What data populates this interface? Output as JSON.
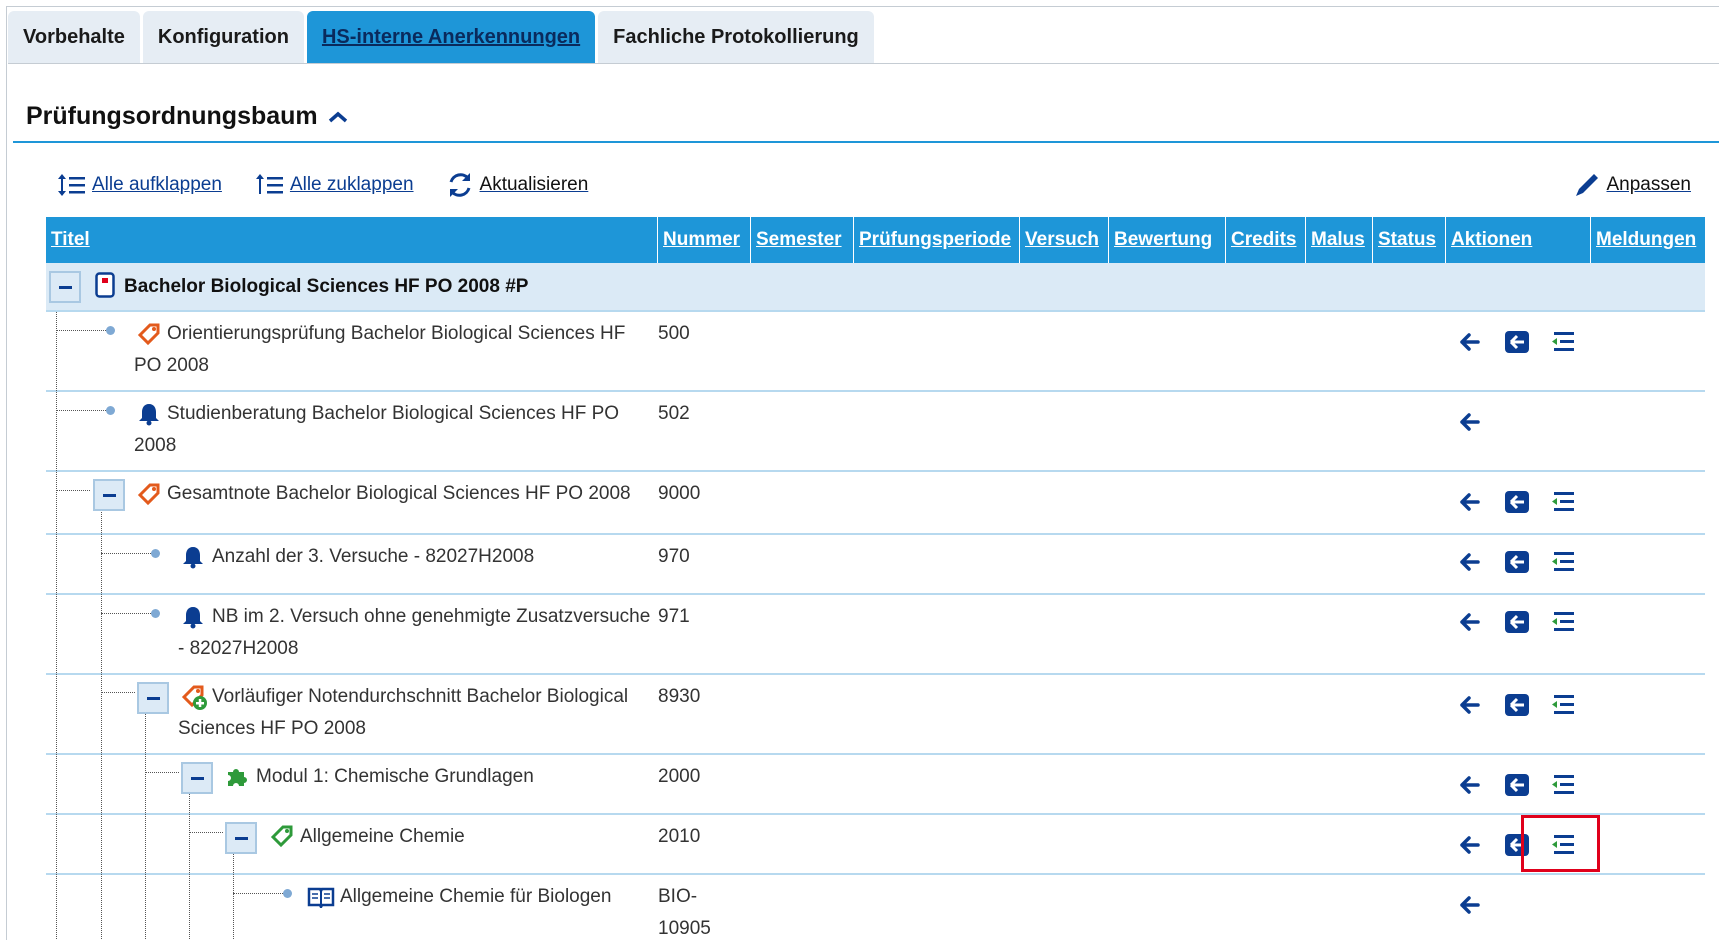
{
  "tabs": [
    {
      "label": "Vorbehalte"
    },
    {
      "label": "Konfiguration"
    },
    {
      "label": "HS-interne Anerkennungen",
      "active": true
    },
    {
      "label": "Fachliche Protokollierung"
    }
  ],
  "section": {
    "title": "Prüfungsordnungsbaum"
  },
  "toolbar": {
    "expand_all": "Alle aufklappen",
    "collapse_all": "Alle zuklappen",
    "refresh": "Aktualisieren",
    "customize": "Anpassen"
  },
  "columns": [
    "Titel",
    "Nummer",
    "Semester",
    "Prüfungsperiode",
    "Versuch",
    "Bewertung",
    "Credits",
    "Malus",
    "Status",
    "Aktionen",
    "Meldungen"
  ],
  "rows": [
    {
      "title": "Bachelor Biological Sciences HF PO 2008 #P",
      "number": "",
      "icon": "document-icon"
    },
    {
      "title_line1": "Orientierungsprüfung Bachelor Biological Sciences HF",
      "title_line2": "PO 2008",
      "number": "500",
      "icon": "tag-icon"
    },
    {
      "title_line1": "Studienberatung Bachelor Biological Sciences HF PO",
      "title_line2": "2008",
      "number": "502",
      "icon": "bell-icon"
    },
    {
      "title_line1": "Gesamtnote Bachelor Biological Sciences HF PO 2008",
      "number": "9000",
      "icon": "tag-icon"
    },
    {
      "title_line1": "Anzahl der 3. Versuche - 82027H2008",
      "number": "970",
      "icon": "bell-icon"
    },
    {
      "title_line1": "NB im 2. Versuch ohne genehmigte Zusatzversuche",
      "title_line2": "- 82027H2008",
      "number": "971",
      "icon": "bell-icon"
    },
    {
      "title_line1": "Vorläufiger Notendurchschnitt Bachelor Biological",
      "title_line2": "Sciences HF PO 2008",
      "number": "8930",
      "icon": "tag-plus-icon"
    },
    {
      "title_line1": "Modul 1: Chemische Grundlagen",
      "number": "2000",
      "icon": "puzzle-icon"
    },
    {
      "title_line1": "Allgemeine Chemie",
      "number": "2010",
      "icon": "tag-green-icon"
    },
    {
      "title_line1": "Allgemeine Chemie für Biologen",
      "number_line1": "BIO-",
      "number_line2": "10905",
      "icon": "book-icon"
    }
  ],
  "colors": {
    "accent": "#1e96d8",
    "link": "#0b3d91",
    "highlight": "#e0001b",
    "tag": "#e35a1c",
    "green": "#2e9a3a"
  }
}
